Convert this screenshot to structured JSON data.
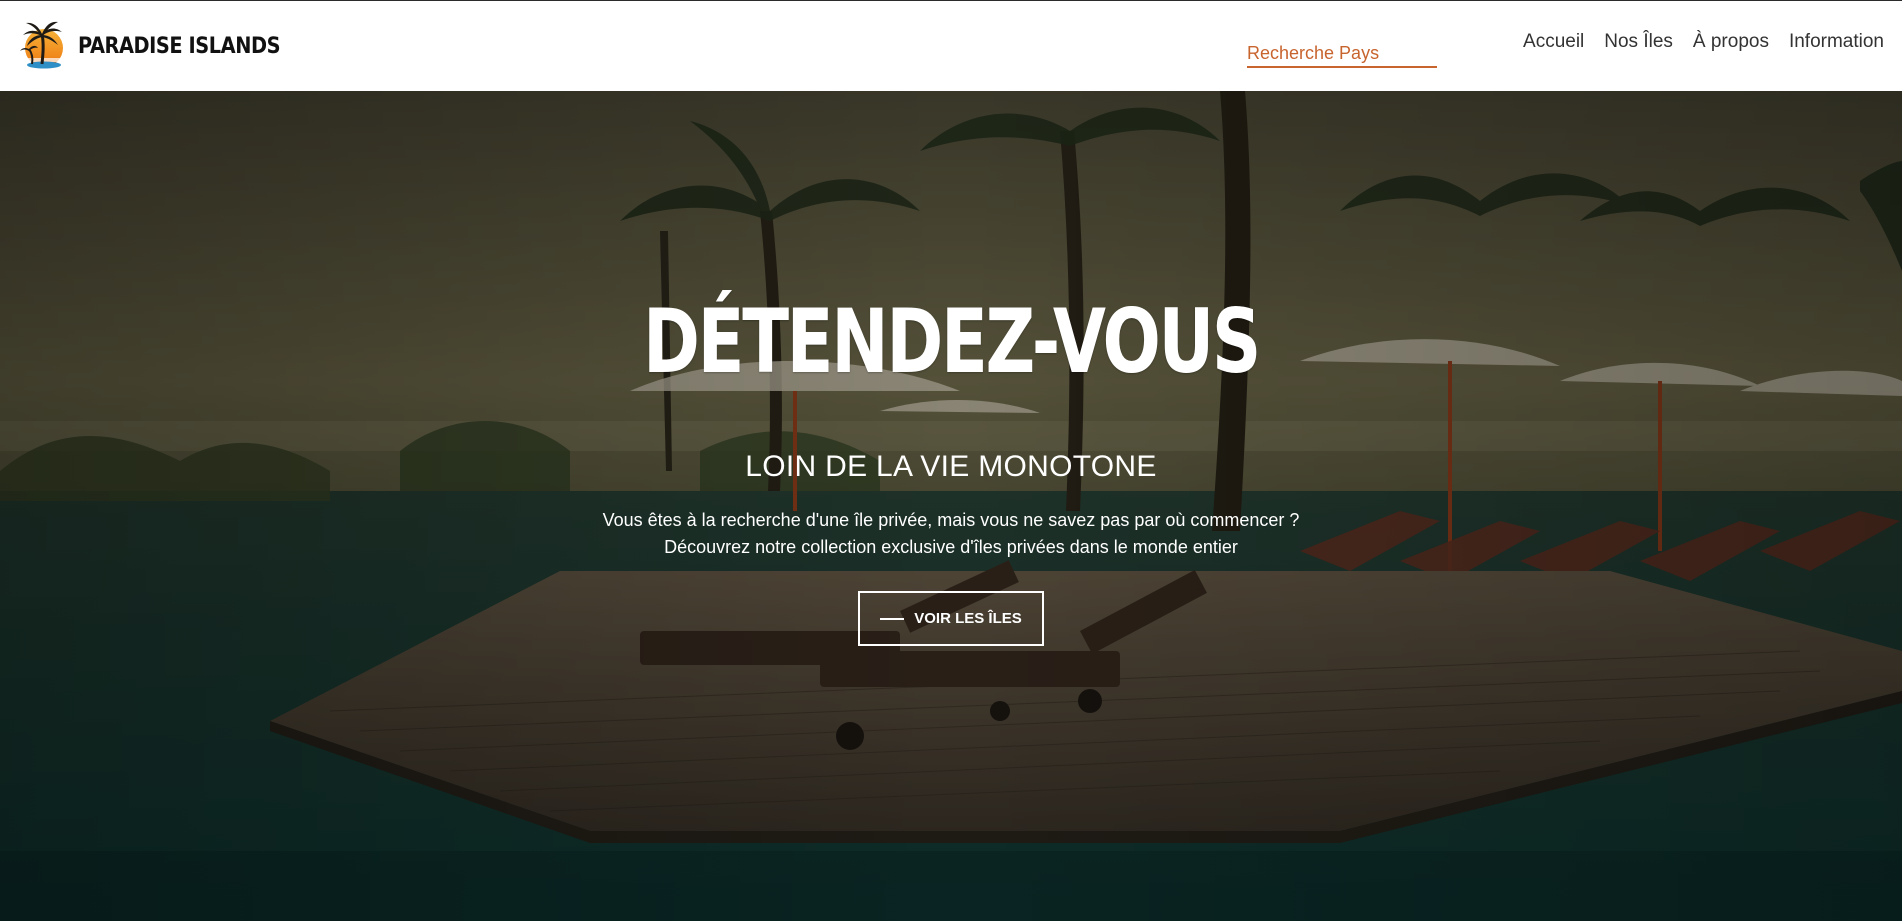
{
  "brand": {
    "name": "PARADISE ISLANDS",
    "logo_icon": "palm-sunset-logo-icon"
  },
  "search": {
    "placeholder": "Recherche Pays",
    "value": ""
  },
  "nav": {
    "items": [
      {
        "label": "Accueil"
      },
      {
        "label": "Nos Îles"
      },
      {
        "label": "À propos"
      },
      {
        "label": "Information"
      }
    ]
  },
  "hero": {
    "title": "DÉTENDEZ-VOUS",
    "subtitle": "LOIN DE LA VIE MONOTONE",
    "text_line_1": "Vous êtes à la recherche d'une île privée, mais vous ne savez pas par où commencer ?",
    "text_line_2": "Découvrez notre collection exclusive d'îles privées dans le monde entier",
    "cta_label": "VOIR LES ÎLES",
    "background": "resort-pool-deck-photo"
  },
  "colors": {
    "accent": "#c8642e",
    "header_bg": "#ffffff",
    "nav_text": "#333333",
    "hero_text": "#ffffff"
  }
}
